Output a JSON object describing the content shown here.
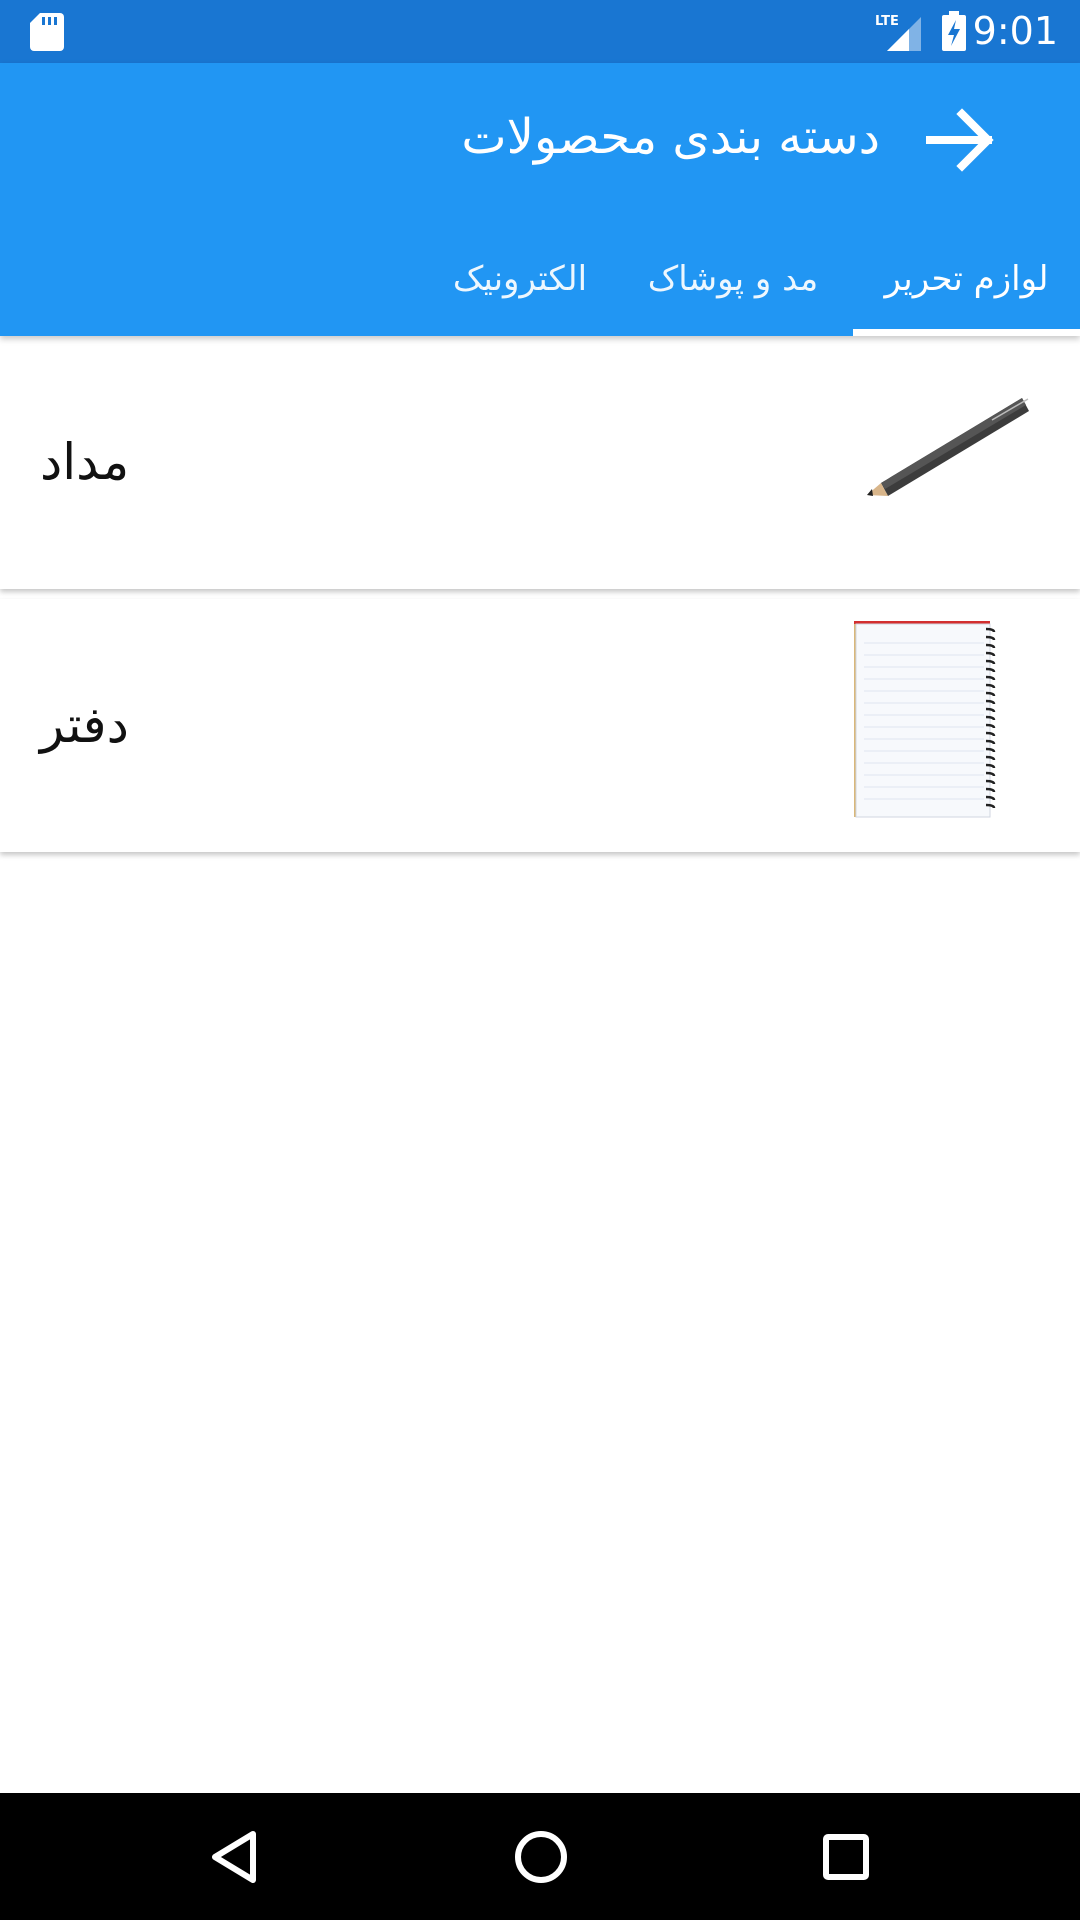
{
  "status_bar": {
    "time": "9:01",
    "network": "LTE",
    "icons": [
      "sd-card-icon",
      "lte-signal-icon",
      "battery-charging-icon"
    ]
  },
  "app_bar": {
    "title": "دسته بندی محصولات",
    "back_icon": "arrow-right-icon",
    "colors": {
      "primary": "#2196f3",
      "primary_dark": "#1976d2"
    }
  },
  "tabs": [
    {
      "label": "لوازم تحریر",
      "selected": true
    },
    {
      "label": "مد و پوشاک",
      "selected": false
    },
    {
      "label": "الکترونیک",
      "selected": false
    }
  ],
  "products": [
    {
      "label": "مداد",
      "image": "pencil-image"
    },
    {
      "label": "دفتر",
      "image": "notebook-image"
    }
  ],
  "nav_bar": {
    "icons": [
      "back-triangle-icon",
      "home-circle-icon",
      "recents-square-icon"
    ]
  }
}
